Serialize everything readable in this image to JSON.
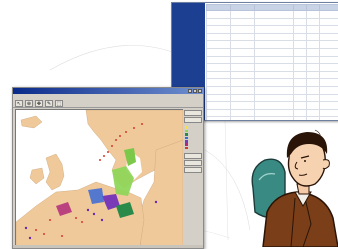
{
  "table_window": {
    "nav_items": [
      "",
      "",
      "",
      "",
      "",
      ""
    ],
    "headers": [
      "",
      "",
      "",
      "",
      "",
      ""
    ],
    "rows": [
      [
        "",
        "",
        "",
        "",
        "",
        ""
      ],
      [
        "",
        "",
        "",
        "",
        "",
        ""
      ],
      [
        "",
        "",
        "",
        "",
        "",
        ""
      ],
      [
        "",
        "",
        "",
        "",
        "",
        ""
      ],
      [
        "",
        "",
        "",
        "",
        "",
        ""
      ],
      [
        "",
        "",
        "",
        "",
        "",
        ""
      ],
      [
        "",
        "",
        "",
        "",
        "",
        ""
      ],
      [
        "",
        "",
        "",
        "",
        "",
        ""
      ],
      [
        "",
        "",
        "",
        "",
        "",
        ""
      ],
      [
        "",
        "",
        "",
        "",
        "",
        ""
      ],
      [
        "",
        "",
        "",
        "",
        "",
        ""
      ],
      [
        "",
        "",
        "",
        "",
        "",
        ""
      ],
      [
        "",
        "",
        "",
        "",
        "",
        ""
      ],
      [
        "",
        "",
        "",
        "",
        "",
        ""
      ],
      [
        "",
        "",
        "",
        "",
        "",
        ""
      ],
      [
        "",
        "",
        "",
        "",
        "",
        ""
      ]
    ]
  },
  "map_window": {
    "title": "",
    "menu": [
      "",
      "",
      "",
      "",
      "",
      ""
    ],
    "side_panel": {
      "top_buttons": [
        "",
        ""
      ],
      "legend_title": "",
      "legend_entries": [
        {
          "color": "#f5e04a",
          "label": ""
        },
        {
          "color": "#8fd65a",
          "label": ""
        },
        {
          "color": "#2a8a4a",
          "label": ""
        },
        {
          "color": "#3a6ad8",
          "label": ""
        },
        {
          "color": "#7a3ab8",
          "label": ""
        },
        {
          "color": "#b02a7a",
          "label": ""
        },
        {
          "color": "#d83a2a",
          "label": ""
        }
      ],
      "section_label": "",
      "bottom_buttons": [
        "",
        "",
        ""
      ]
    }
  },
  "colors": {
    "table_nav_bg": "#1d3f91",
    "land": "#f0c99a",
    "sea": "#ffffff",
    "title_bar": "#0a2a8a",
    "legend_highlight": "#8fd65a"
  }
}
